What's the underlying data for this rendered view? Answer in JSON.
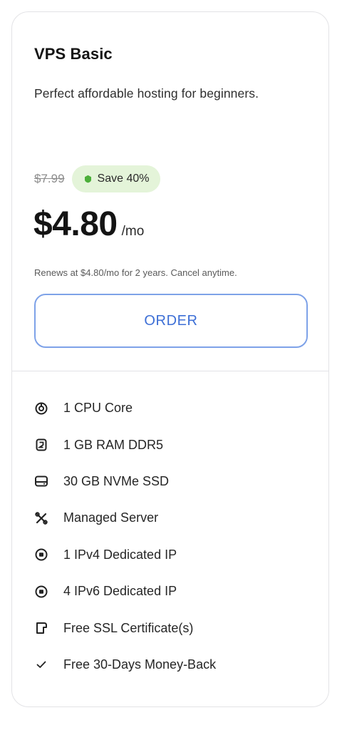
{
  "plan": {
    "title": "VPS Basic",
    "description": "Perfect affordable hosting for beginners."
  },
  "pricing": {
    "original_price": "$7.99",
    "save_label": "Save 40%",
    "current_price": "$4.80",
    "period": "/mo",
    "renewal_note": "Renews at $4.80/mo for 2 years. Cancel anytime."
  },
  "order_button": {
    "label": "ORDER"
  },
  "features": [
    {
      "icon": "cpu-icon",
      "label": "1 CPU Core"
    },
    {
      "icon": "memory-icon",
      "label": "1 GB RAM DDR5"
    },
    {
      "icon": "storage-icon",
      "label": "30 GB NVMe SSD"
    },
    {
      "icon": "tools-icon",
      "label": "Managed Server"
    },
    {
      "icon": "ip-icon",
      "label": "1 IPv4 Dedicated IP"
    },
    {
      "icon": "ip-icon",
      "label": "4 IPv6 Dedicated IP"
    },
    {
      "icon": "certificate-icon",
      "label": "Free SSL Certificate(s)"
    },
    {
      "icon": "check-icon",
      "label": "Free 30-Days Money-Back"
    }
  ],
  "colors": {
    "accent": "#3d6fd6",
    "button_border": "#7ea2e8",
    "badge_background": "#e4f4d9",
    "badge_icon": "#4caf3a",
    "card_border": "#e3e3e6"
  }
}
